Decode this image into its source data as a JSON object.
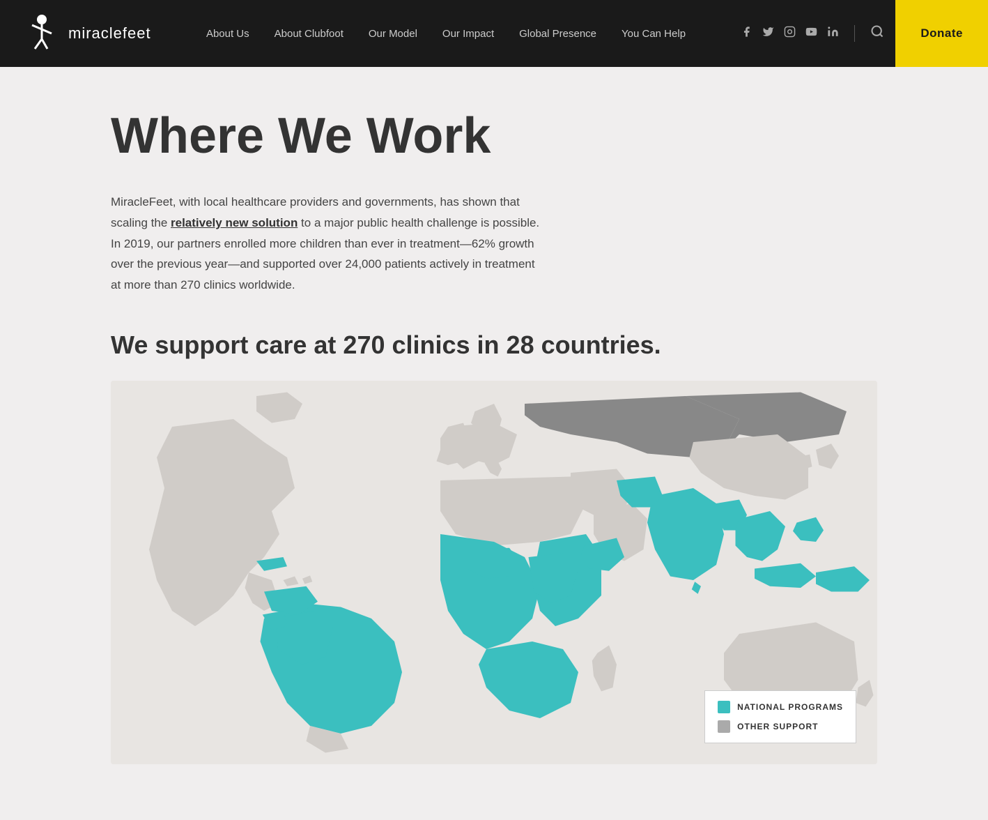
{
  "nav": {
    "logo_text": "miraclefeet",
    "links": [
      {
        "label": "About Us",
        "href": "#"
      },
      {
        "label": "About Clubfoot",
        "href": "#"
      },
      {
        "label": "Our Model",
        "href": "#"
      },
      {
        "label": "Our Impact",
        "href": "#"
      },
      {
        "label": "Global Presence",
        "href": "#"
      },
      {
        "label": "You Can Help",
        "href": "#"
      }
    ],
    "donate_label": "Donate",
    "social": [
      {
        "name": "facebook",
        "icon": "f"
      },
      {
        "name": "twitter",
        "icon": "𝕏"
      },
      {
        "name": "instagram",
        "icon": "📷"
      },
      {
        "name": "youtube",
        "icon": "▶"
      },
      {
        "name": "linkedin",
        "icon": "in"
      }
    ]
  },
  "main": {
    "page_title": "Where We Work",
    "intro_paragraph": "MiracleFeet, with local healthcare providers and governments, has shown that scaling the ",
    "intro_link_text": "relatively new solution",
    "intro_paragraph2": " to a major public health challenge is possible. In 2019, our partners enrolled more children than ever in treatment—62% growth over the previous year—and supported over 24,000 patients actively in treatment at more than 270 clinics worldwide.",
    "clinics_heading": "We support care at 270 clinics in 28 countries.",
    "legend": {
      "national_programs": "NATIONAL PROGRAMS",
      "other_support": "OTHER SUPPORT"
    }
  }
}
